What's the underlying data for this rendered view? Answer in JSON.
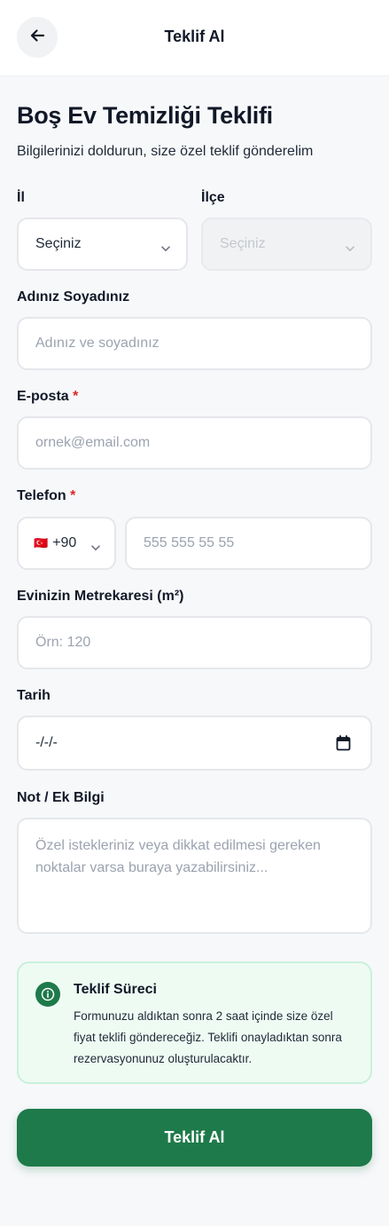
{
  "header": {
    "title": "Teklif Al"
  },
  "page": {
    "title": "Boş Ev Temizliği Teklifi",
    "subtitle": "Bilgilerinizi doldurun, size özel teklif gönderelim"
  },
  "form": {
    "il": {
      "label": "İl",
      "value": "Seçiniz"
    },
    "ilce": {
      "label": "İlçe",
      "placeholder": "Seçiniz"
    },
    "name": {
      "label": "Adınız Soyadınız",
      "placeholder": "Adınız ve soyadınız"
    },
    "email": {
      "label": "E-posta",
      "required_mark": "*",
      "placeholder": "ornek@email.com"
    },
    "phone": {
      "label": "Telefon",
      "required_mark": "*",
      "flag": "🇹🇷",
      "country_code": "+90",
      "placeholder": "555 555 55 55"
    },
    "area": {
      "label": "Evinizin Metrekaresi (m²)",
      "placeholder": "Örn: 120"
    },
    "date": {
      "label": "Tarih",
      "value": "-/-/-"
    },
    "note": {
      "label": "Not / Ek Bilgi",
      "placeholder": "Özel istekleriniz veya dikkat edilmesi gereken noktalar varsa buraya yazabilirsiniz..."
    }
  },
  "info": {
    "title": "Teklif Süreci",
    "text": "Formunuzu aldıktan sonra 2 saat içinde size özel fiyat teklifi göndereceğiz. Teklifi onayladıktan sonra rezervasyonunuz oluşturulacaktır."
  },
  "submit_label": "Teklif Al",
  "colors": {
    "primary": "#1e7a4a",
    "required": "#dc2626",
    "info_bg": "#eefbf3"
  }
}
